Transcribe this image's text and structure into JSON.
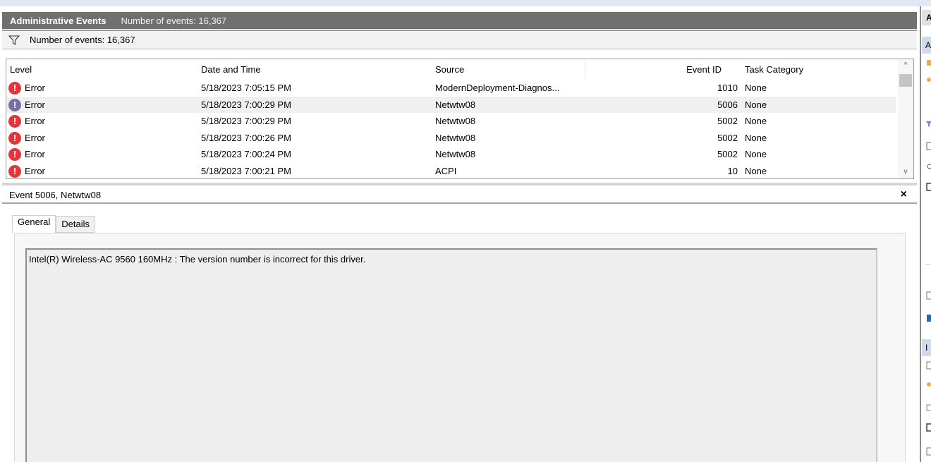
{
  "header": {
    "title": "Administrative Events",
    "count_text": "Number of events: 16,367"
  },
  "filter": {
    "count_text": "Number of events: 16,367"
  },
  "list": {
    "columns": [
      "Level",
      "Date and Time",
      "Source",
      "Event ID",
      "Task Category"
    ],
    "rows": [
      {
        "level": "Error",
        "datetime": "5/18/2023 7:05:15 PM",
        "source": "ModernDeployment-Diagnos...",
        "event_id": "1010",
        "task": "None"
      },
      {
        "level": "Error",
        "datetime": "5/18/2023 7:00:29 PM",
        "source": "Netwtw08",
        "event_id": "5006",
        "task": "None"
      },
      {
        "level": "Error",
        "datetime": "5/18/2023 7:00:29 PM",
        "source": "Netwtw08",
        "event_id": "5002",
        "task": "None"
      },
      {
        "level": "Error",
        "datetime": "5/18/2023 7:00:26 PM",
        "source": "Netwtw08",
        "event_id": "5002",
        "task": "None"
      },
      {
        "level": "Error",
        "datetime": "5/18/2023 7:00:24 PM",
        "source": "Netwtw08",
        "event_id": "5002",
        "task": "None"
      },
      {
        "level": "Error",
        "datetime": "5/18/2023 7:00:21 PM",
        "source": "ACPI",
        "event_id": "10",
        "task": "None"
      }
    ],
    "selected_row": 1,
    "error_icon_glyph": "!"
  },
  "details": {
    "title": "Event 5006, Netwtw08",
    "close_glyph": "×",
    "tabs": [
      "General",
      "Details"
    ],
    "active_tab": "General",
    "message": "Intel(R) Wireless-AC 9560 160MHz : The version number is incorrect for this driver."
  },
  "actions": {
    "header_letter": "A",
    "sub_letter_1": "A",
    "sub_letter_2": "I"
  },
  "scroll": {
    "up_glyph": "^",
    "down_glyph": "v"
  },
  "colors": {
    "header_bg": "#707070",
    "error_icon": "#e0373d",
    "selected_row_bg": "#f0f0f0",
    "actions_highlight": "#cfdbea"
  },
  "icons": {
    "filter": "funnel-icon",
    "error": "error-circle-icon",
    "close": "close-icon"
  }
}
